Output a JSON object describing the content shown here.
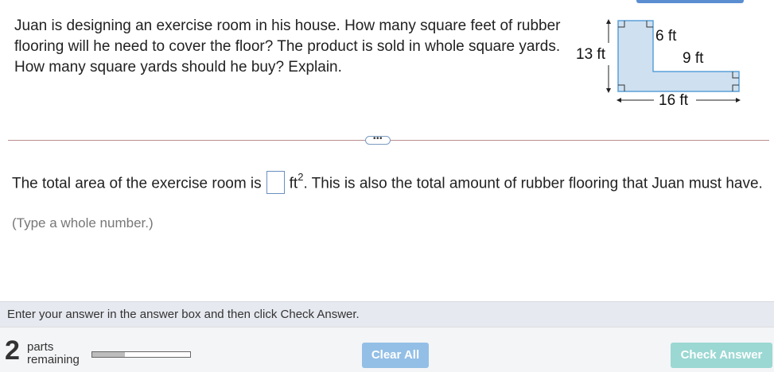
{
  "question": {
    "text": "Juan is designing an exercise room in his house. How many square feet of rubber flooring will he need to cover the floor? The product is sold in whole square yards. How many square yards should he buy? Explain."
  },
  "figure": {
    "labels": {
      "left": "13 ft",
      "top": "6 ft",
      "step": "9 ft",
      "bottom": "16 ft"
    },
    "fill_color": "#cfe0f0",
    "stroke_color": "#5aa0d8"
  },
  "divider": {
    "handle_label": "•••"
  },
  "answer": {
    "prefix": "The total area of the exercise room is",
    "unit": "ft",
    "exponent": "2",
    "suffix": ". This is also the total amount of rubber flooring that Juan must have.",
    "input_value": "",
    "hint": "(Type a whole number.)"
  },
  "status": {
    "text": "Enter your answer in the answer box and then click Check Answer."
  },
  "footer": {
    "parts_count": "2",
    "parts_label_1": "parts",
    "parts_label_2": "remaining",
    "progress": 0.33,
    "clear_all_label": "Clear All",
    "check_answer_label": "Check Answer"
  },
  "colors": {
    "clear_button": "#93bfe6",
    "check_button": "#9bd8d3",
    "status_bar": "#e6e9ef"
  }
}
